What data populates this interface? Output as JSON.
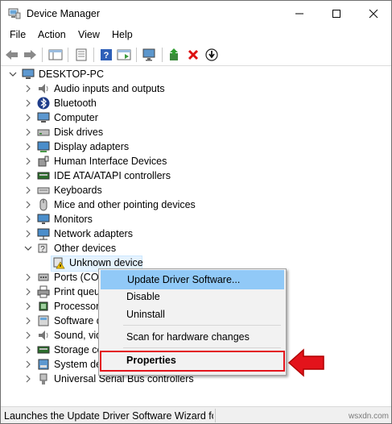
{
  "window": {
    "title": "Device Manager"
  },
  "menu": [
    "File",
    "Action",
    "View",
    "Help"
  ],
  "tree": {
    "root": "DESKTOP-PC",
    "items": [
      {
        "label": "Audio inputs and outputs",
        "icon": "speaker-icon"
      },
      {
        "label": "Bluetooth",
        "icon": "bluetooth-icon"
      },
      {
        "label": "Computer",
        "icon": "computer-icon"
      },
      {
        "label": "Disk drives",
        "icon": "disk-drive-icon"
      },
      {
        "label": "Display adapters",
        "icon": "display-adapter-icon"
      },
      {
        "label": "Human Interface Devices",
        "icon": "hid-icon"
      },
      {
        "label": "IDE ATA/ATAPI controllers",
        "icon": "ide-controller-icon"
      },
      {
        "label": "Keyboards",
        "icon": "keyboard-icon"
      },
      {
        "label": "Mice and other pointing devices",
        "icon": "mouse-icon"
      },
      {
        "label": "Monitors",
        "icon": "monitor-icon"
      },
      {
        "label": "Network adapters",
        "icon": "network-adapter-icon"
      },
      {
        "label": "Other devices",
        "icon": "other-devices-icon"
      },
      {
        "label": "Unknown device",
        "icon": "unknown-device-warning-icon"
      },
      {
        "label": "Ports (COM",
        "icon": "port-icon"
      },
      {
        "label": "Print queu",
        "icon": "printer-icon"
      },
      {
        "label": "Processors",
        "icon": "processor-icon"
      },
      {
        "label": "Software d",
        "icon": "software-device-icon"
      },
      {
        "label": "Sound, vid",
        "icon": "sound-icon"
      },
      {
        "label": "Storage co",
        "icon": "storage-controller-icon"
      },
      {
        "label": "System de",
        "icon": "system-device-icon"
      },
      {
        "label": "Universal Serial Bus controllers",
        "icon": "usb-icon"
      }
    ]
  },
  "context_menu": {
    "update": "Update Driver Software...",
    "disable": "Disable",
    "uninstall": "Uninstall",
    "scan": "Scan for hardware changes",
    "properties": "Properties"
  },
  "status": {
    "text": "Launches the Update Driver Software Wizard for th"
  },
  "watermark": "wsxdn.com",
  "colors": {
    "highlight": "#91c9f7",
    "annotation": "#e3131b",
    "selection": "#e5f3ff"
  }
}
